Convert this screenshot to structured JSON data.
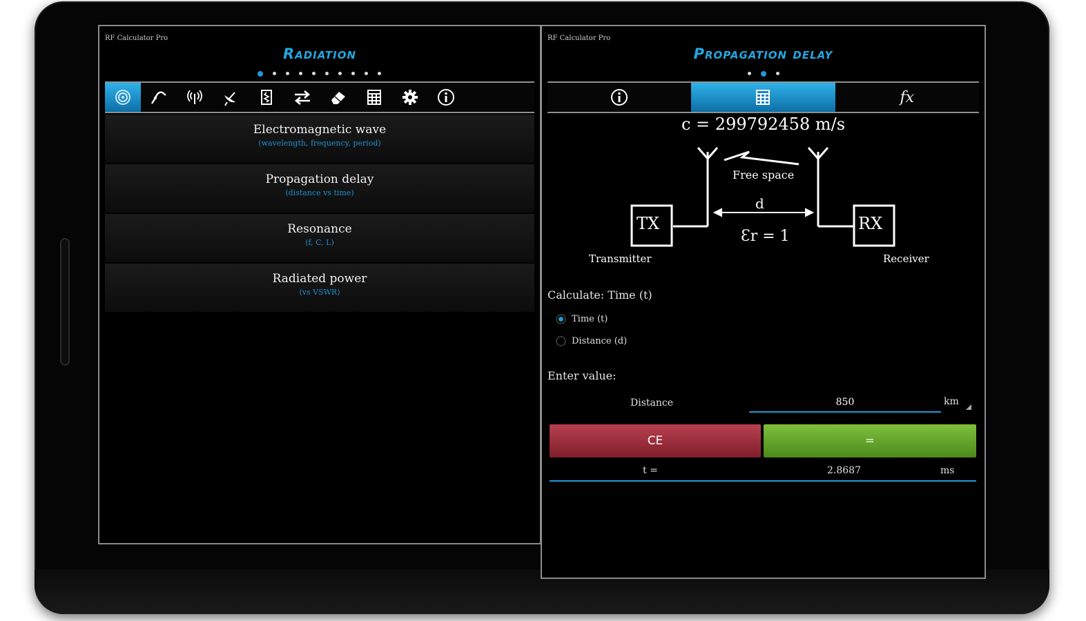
{
  "left_screen": {
    "app_title": "RF Calculator Pro",
    "page_title": "Radiation",
    "page_dots": 10,
    "active_dot": 0,
    "toolbar_icons": [
      "radiation-icon",
      "curve-icon",
      "antenna-icon",
      "satellite-dish-icon",
      "resistor-icon",
      "transfer-arrows-icon",
      "eraser-icon",
      "calculator-icon",
      "gear-icon",
      "info-icon"
    ],
    "active_tab": 0,
    "items": [
      {
        "title": "Electromagnetic wave",
        "subtitle": "(wavelength, frequency, period)"
      },
      {
        "title": "Propagation delay",
        "subtitle": "(distance vs time)"
      },
      {
        "title": "Resonance",
        "subtitle": "(f, C, L)"
      },
      {
        "title": "Radiated power",
        "subtitle": "(vs VSWR)"
      }
    ]
  },
  "right_screen": {
    "app_title": "RF Calculator Pro",
    "page_title": "Propagation delay",
    "page_dots": 3,
    "active_dot": 1,
    "tabs": [
      {
        "icon": "info-icon",
        "glyph": "ⓘ"
      },
      {
        "icon": "calculator-icon",
        "glyph": "▦"
      },
      {
        "icon": "function-icon",
        "glyph": "fx"
      }
    ],
    "active_tab": 1,
    "formula": "c = 299792458 m/s",
    "diagram": {
      "free_space": "Free space",
      "distance": "d",
      "permittivity": "Ɛr = 1",
      "tx": "TX",
      "rx": "RX",
      "transmitter": "Transmitter",
      "receiver": "Receiver"
    },
    "calculate_label": "Calculate: Time (t)",
    "options": [
      {
        "label": "Time (t)",
        "selected": true
      },
      {
        "label": "Distance (d)",
        "selected": false
      }
    ],
    "enter_value_label": "Enter value:",
    "distance_label": "Distance",
    "distance_value": "850",
    "distance_unit": "km",
    "ce_label": "CE",
    "equals_label": "=",
    "result_label": "t =",
    "result_value": "2.8687",
    "result_unit": "ms"
  },
  "colors": {
    "accent": "#23a7e0",
    "ce_button": "#a3323f",
    "equals_button": "#6aac2f"
  }
}
